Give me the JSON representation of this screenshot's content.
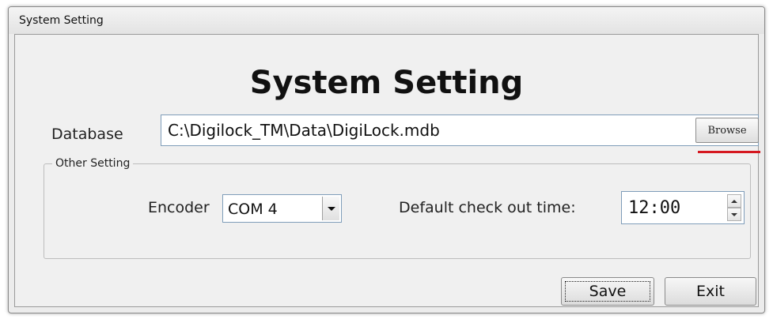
{
  "window": {
    "title": "System Setting"
  },
  "heading": "System Setting",
  "database": {
    "label": "Database",
    "path": "C:\\Digilock_TM\\Data\\DigiLock.mdb",
    "browse_label": "Browse"
  },
  "other_setting": {
    "legend": "Other Setting",
    "encoder_label": "Encoder",
    "encoder_value": "COM 4",
    "checkout_label": "Default check out time:",
    "checkout_value": "12:00"
  },
  "buttons": {
    "save": "Save",
    "exit": "Exit"
  },
  "colors": {
    "highlight_underline": "#d51820"
  }
}
